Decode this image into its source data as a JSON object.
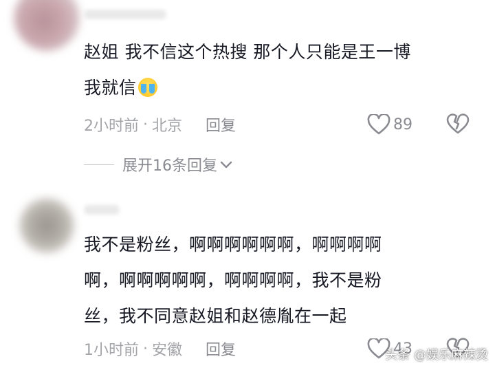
{
  "comments": [
    {
      "text_line1": "赵姐 我不信这个热搜 那个人只能是王一博",
      "text_line2": "我就信",
      "emoji": "crying-face",
      "time": "2小时前",
      "separator": "·",
      "location": "北京",
      "reply_label": "回复",
      "likes": "89",
      "expand_label": "展开16条回复"
    },
    {
      "text_line1": "我不是粉丝，啊啊啊啊啊啊，啊啊啊啊",
      "text_line2": "啊，啊啊啊啊啊，啊啊啊啊，我不是粉",
      "text_line3": "丝，我不同意赵姐和赵德胤在一起",
      "time": "1小时前",
      "separator": "·",
      "location": "安徽",
      "reply_label": "回复",
      "likes": "43"
    }
  ],
  "watermark": "头条 @娱乐麻辣烫",
  "colors": {
    "text": "#161823",
    "meta": "#a3a4a8",
    "icon": "#8a8b91",
    "background": "#ffffff"
  }
}
